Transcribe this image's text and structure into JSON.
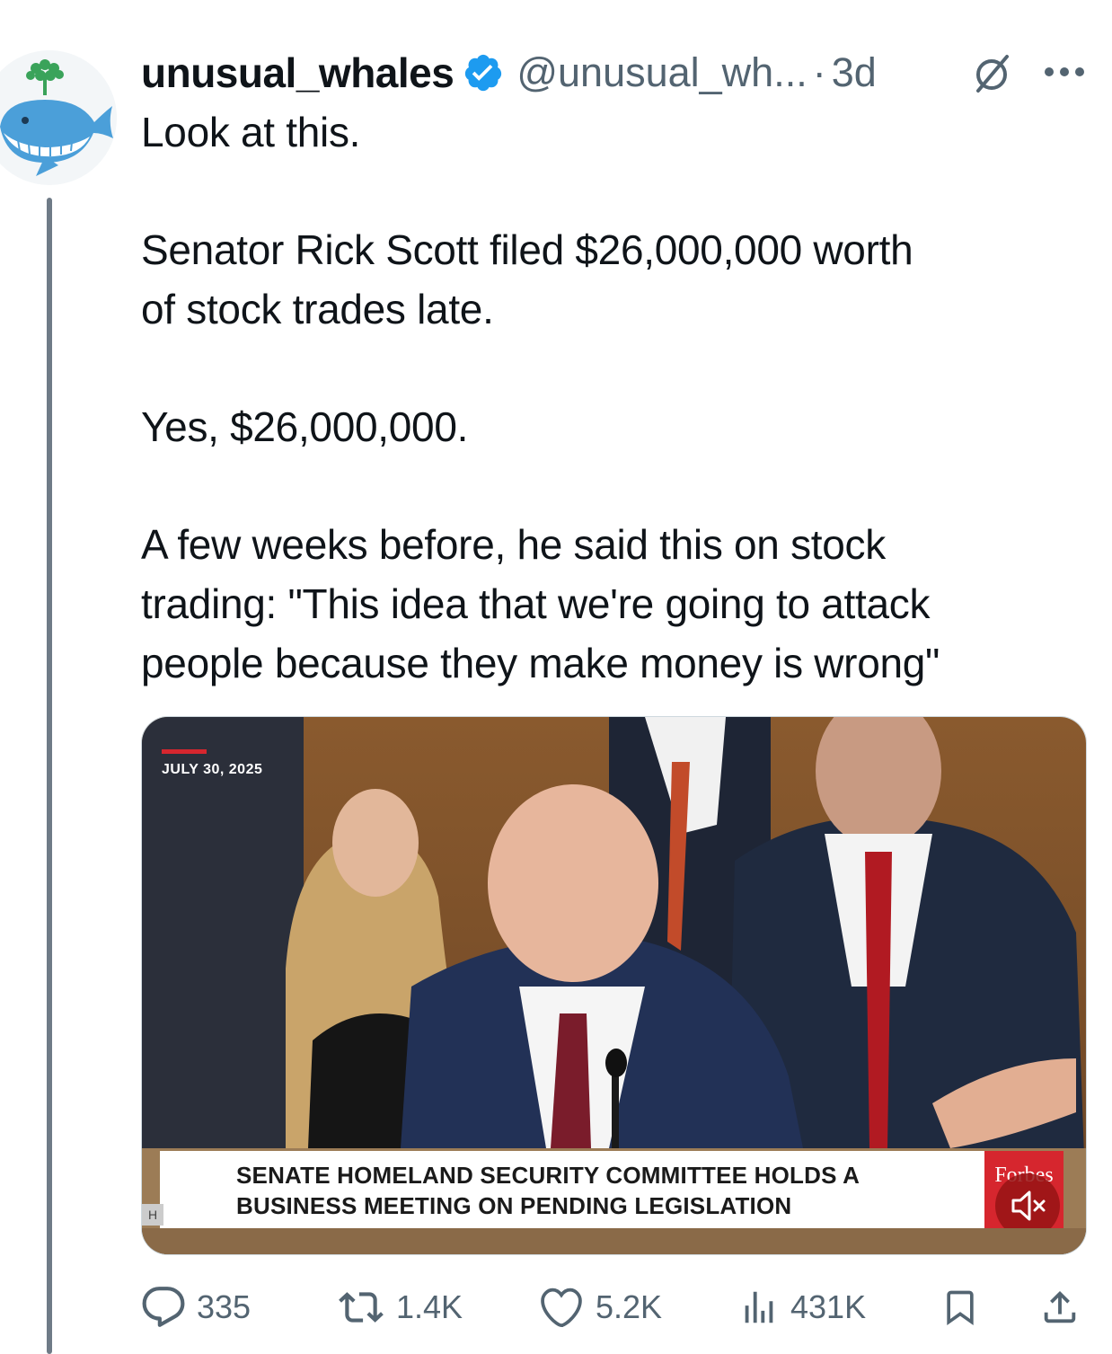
{
  "tweet": {
    "display_name": "unusual_whales",
    "handle": "@unusual_wh...",
    "separator": "·",
    "time": "3d",
    "lines": [
      "Look at this.",
      "Senator Rick Scott filed $26,000,000 worth",
      "of stock trades late.",
      "Yes, $26,000,000.",
      "A few weeks before, he said this on stock",
      "trading: \"This idea that we're going to attack",
      "people because they make money is wrong\""
    ]
  },
  "media": {
    "date_label": "JULY 30, 2025",
    "lower_third_line1": "SENATE HOMELAND SECURITY COMMITTEE HOLDS A",
    "lower_third_line2": "BUSINESS MEETING ON PENDING LEGISLATION",
    "lower_left_tag": "H",
    "brand": "Forbes"
  },
  "actions": {
    "replies": "335",
    "reposts": "1.4K",
    "likes": "5.2K",
    "views": "431K"
  },
  "colors": {
    "verified": "#1d9bf0",
    "secondary_text": "#536471",
    "forbes_red": "#d6262e"
  },
  "icons": [
    "whale-avatar",
    "verified-badge-icon",
    "grok-icon",
    "more-icon",
    "reply-icon",
    "repost-icon",
    "like-icon",
    "views-icon",
    "bookmark-icon",
    "share-icon",
    "mute-icon"
  ]
}
